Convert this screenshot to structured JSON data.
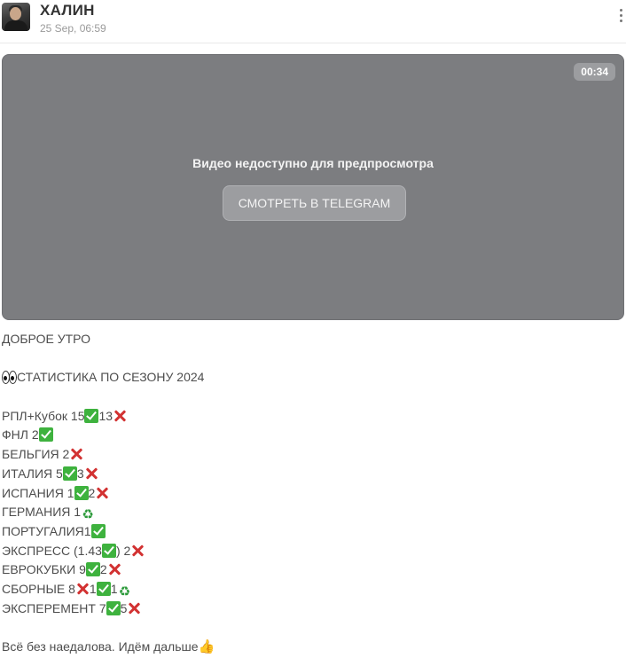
{
  "header": {
    "channel_name": "ХАЛИН",
    "timestamp": "25 Sep, 06:59"
  },
  "video": {
    "duration": "00:34",
    "unavailable_text": "Видео недоступно для предпросмотра",
    "watch_button_label": "СМОТРЕТЬ В TELEGRAM"
  },
  "post": {
    "greeting": "ДОБРОЕ УТРО",
    "stats_title": "СТАТИСТИКА ПО СЕЗОНУ 2024",
    "stats": [
      {
        "label": "РПЛ+Кубок ",
        "v1": "15",
        "v2": "13"
      },
      {
        "label": "ФНЛ ",
        "v1": "2"
      },
      {
        "label": "БЕЛЬГИЯ ",
        "v1": "2"
      },
      {
        "label": "ИТАЛИЯ ",
        "v1": "5",
        "v2": "3"
      },
      {
        "label": "ИСПАНИЯ ",
        "v1": "1",
        "v2": "2"
      },
      {
        "label": "ГЕРМАНИЯ ",
        "v1": "1"
      },
      {
        "label": "ПОРТУГАЛИЯ",
        "v1": "1"
      },
      {
        "label": "ЭКСПРЕСС (1.43",
        "v1": ")",
        "v2": " 2"
      },
      {
        "label": "ЕВРОКУБКИ ",
        "v1": "9",
        "v2": "2"
      },
      {
        "label": "СБОРНЫЕ ",
        "v1": "8",
        "v2": "1",
        "v3": "1"
      },
      {
        "label": "ЭКСПЕРЕМЕНТ ",
        "v1": "7",
        "v2": "5"
      }
    ],
    "closing": "Всё без наедалова. Идём дальше"
  },
  "icons": {
    "win": "check-mark-icon",
    "loss": "cross-mark-icon",
    "refund": "recycle-icon",
    "eyes": "eyes-icon",
    "thumbs": "thumbs-up-icon",
    "menu": "more-vertical-icon"
  },
  "colors": {
    "video_bg": "#7c7d80",
    "check_green": "#3eb23e",
    "cross_red": "#d23232",
    "text": "#4d4d4d"
  }
}
